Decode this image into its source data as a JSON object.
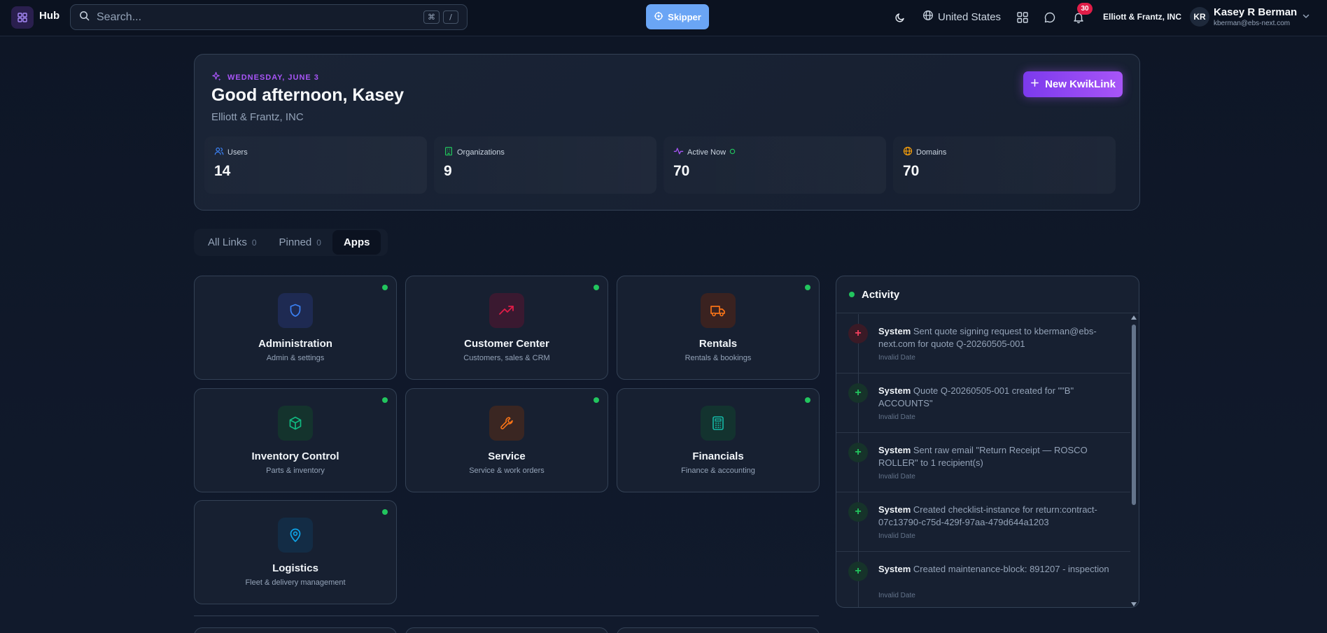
{
  "topbar": {
    "brand": "Hub",
    "search_placeholder": "Search...",
    "shortcut_keys": [
      "⌘",
      "/"
    ],
    "skipper_label": "Skipper",
    "region": "United States",
    "notifications_count": "30",
    "org_name": "Elliott & Frantz, INC",
    "user_initials": "KR",
    "user_name": "Kasey R Berman",
    "user_email": "kberman@ebs-next.com",
    "icons": [
      "grid-icon",
      "search-icon",
      "moon-icon",
      "globe-icon",
      "apps-grid-icon",
      "chat-icon",
      "bell-icon",
      "chevron-down-icon"
    ]
  },
  "hero": {
    "date": "WEDNESDAY, JUNE 3",
    "greeting": "Good afternoon, Kasey",
    "company": "Elliott & Frantz, INC",
    "new_button": "New KwikLink",
    "stats": [
      {
        "label": "Users",
        "value": "14",
        "icon": "users-icon",
        "color": "#3b82f6"
      },
      {
        "label": "Organizations",
        "value": "9",
        "icon": "building-icon",
        "color": "#22c55e"
      },
      {
        "label": "Active Now",
        "value": "70",
        "icon": "activity-icon",
        "color": "#a855f7"
      },
      {
        "label": "Domains",
        "value": "70",
        "icon": "globe-icon",
        "color": "#f59e0b"
      }
    ]
  },
  "tabs": [
    {
      "label": "All Links",
      "count": "0"
    },
    {
      "label": "Pinned",
      "count": "0"
    },
    {
      "label": "Apps",
      "count": ""
    }
  ],
  "apps": [
    {
      "title": "Administration",
      "subtitle": "Admin & settings",
      "icon": "shield-icon",
      "color": "#3b82f6"
    },
    {
      "title": "Customer Center",
      "subtitle": "Customers, sales & CRM",
      "icon": "trending-up-icon",
      "color": "#e11d48"
    },
    {
      "title": "Rentals",
      "subtitle": "Rentals & bookings",
      "icon": "truck-icon",
      "color": "#f97316"
    },
    {
      "title": "Inventory Control",
      "subtitle": "Parts & inventory",
      "icon": "box-icon",
      "color": "#10b981"
    },
    {
      "title": "Service",
      "subtitle": "Service & work orders",
      "icon": "wrench-icon",
      "color": "#f97316"
    },
    {
      "title": "Financials",
      "subtitle": "Finance & accounting",
      "icon": "calculator-icon",
      "color": "#14b8a6"
    },
    {
      "title": "Logistics",
      "subtitle": "Fleet & delivery management",
      "icon": "map-pin-icon",
      "color": "#0ea5e9"
    }
  ],
  "activity": {
    "title": "Activity",
    "items": [
      {
        "actor": "System",
        "text": "Sent quote signing request to kberman@ebs-next.com for quote Q-20260505-001",
        "time": "Invalid Date",
        "kind": "red"
      },
      {
        "actor": "System",
        "text": "Quote Q-20260505-001 created for \"\"B\" ACCOUNTS\"",
        "time": "Invalid Date",
        "kind": "green"
      },
      {
        "actor": "System",
        "text": "Sent raw email \"Return Receipt — ROSCO ROLLER\" to 1 recipient(s)",
        "time": "Invalid Date",
        "kind": "green"
      },
      {
        "actor": "System",
        "text": "Created checklist-instance for return:contract-07c13790-c75d-429f-97aa-479d644a1203",
        "time": "Invalid Date",
        "kind": "green"
      },
      {
        "actor": "System",
        "text": "Created maintenance-block: 891207 - inspection",
        "time": "Invalid Date",
        "kind": "green"
      }
    ]
  }
}
